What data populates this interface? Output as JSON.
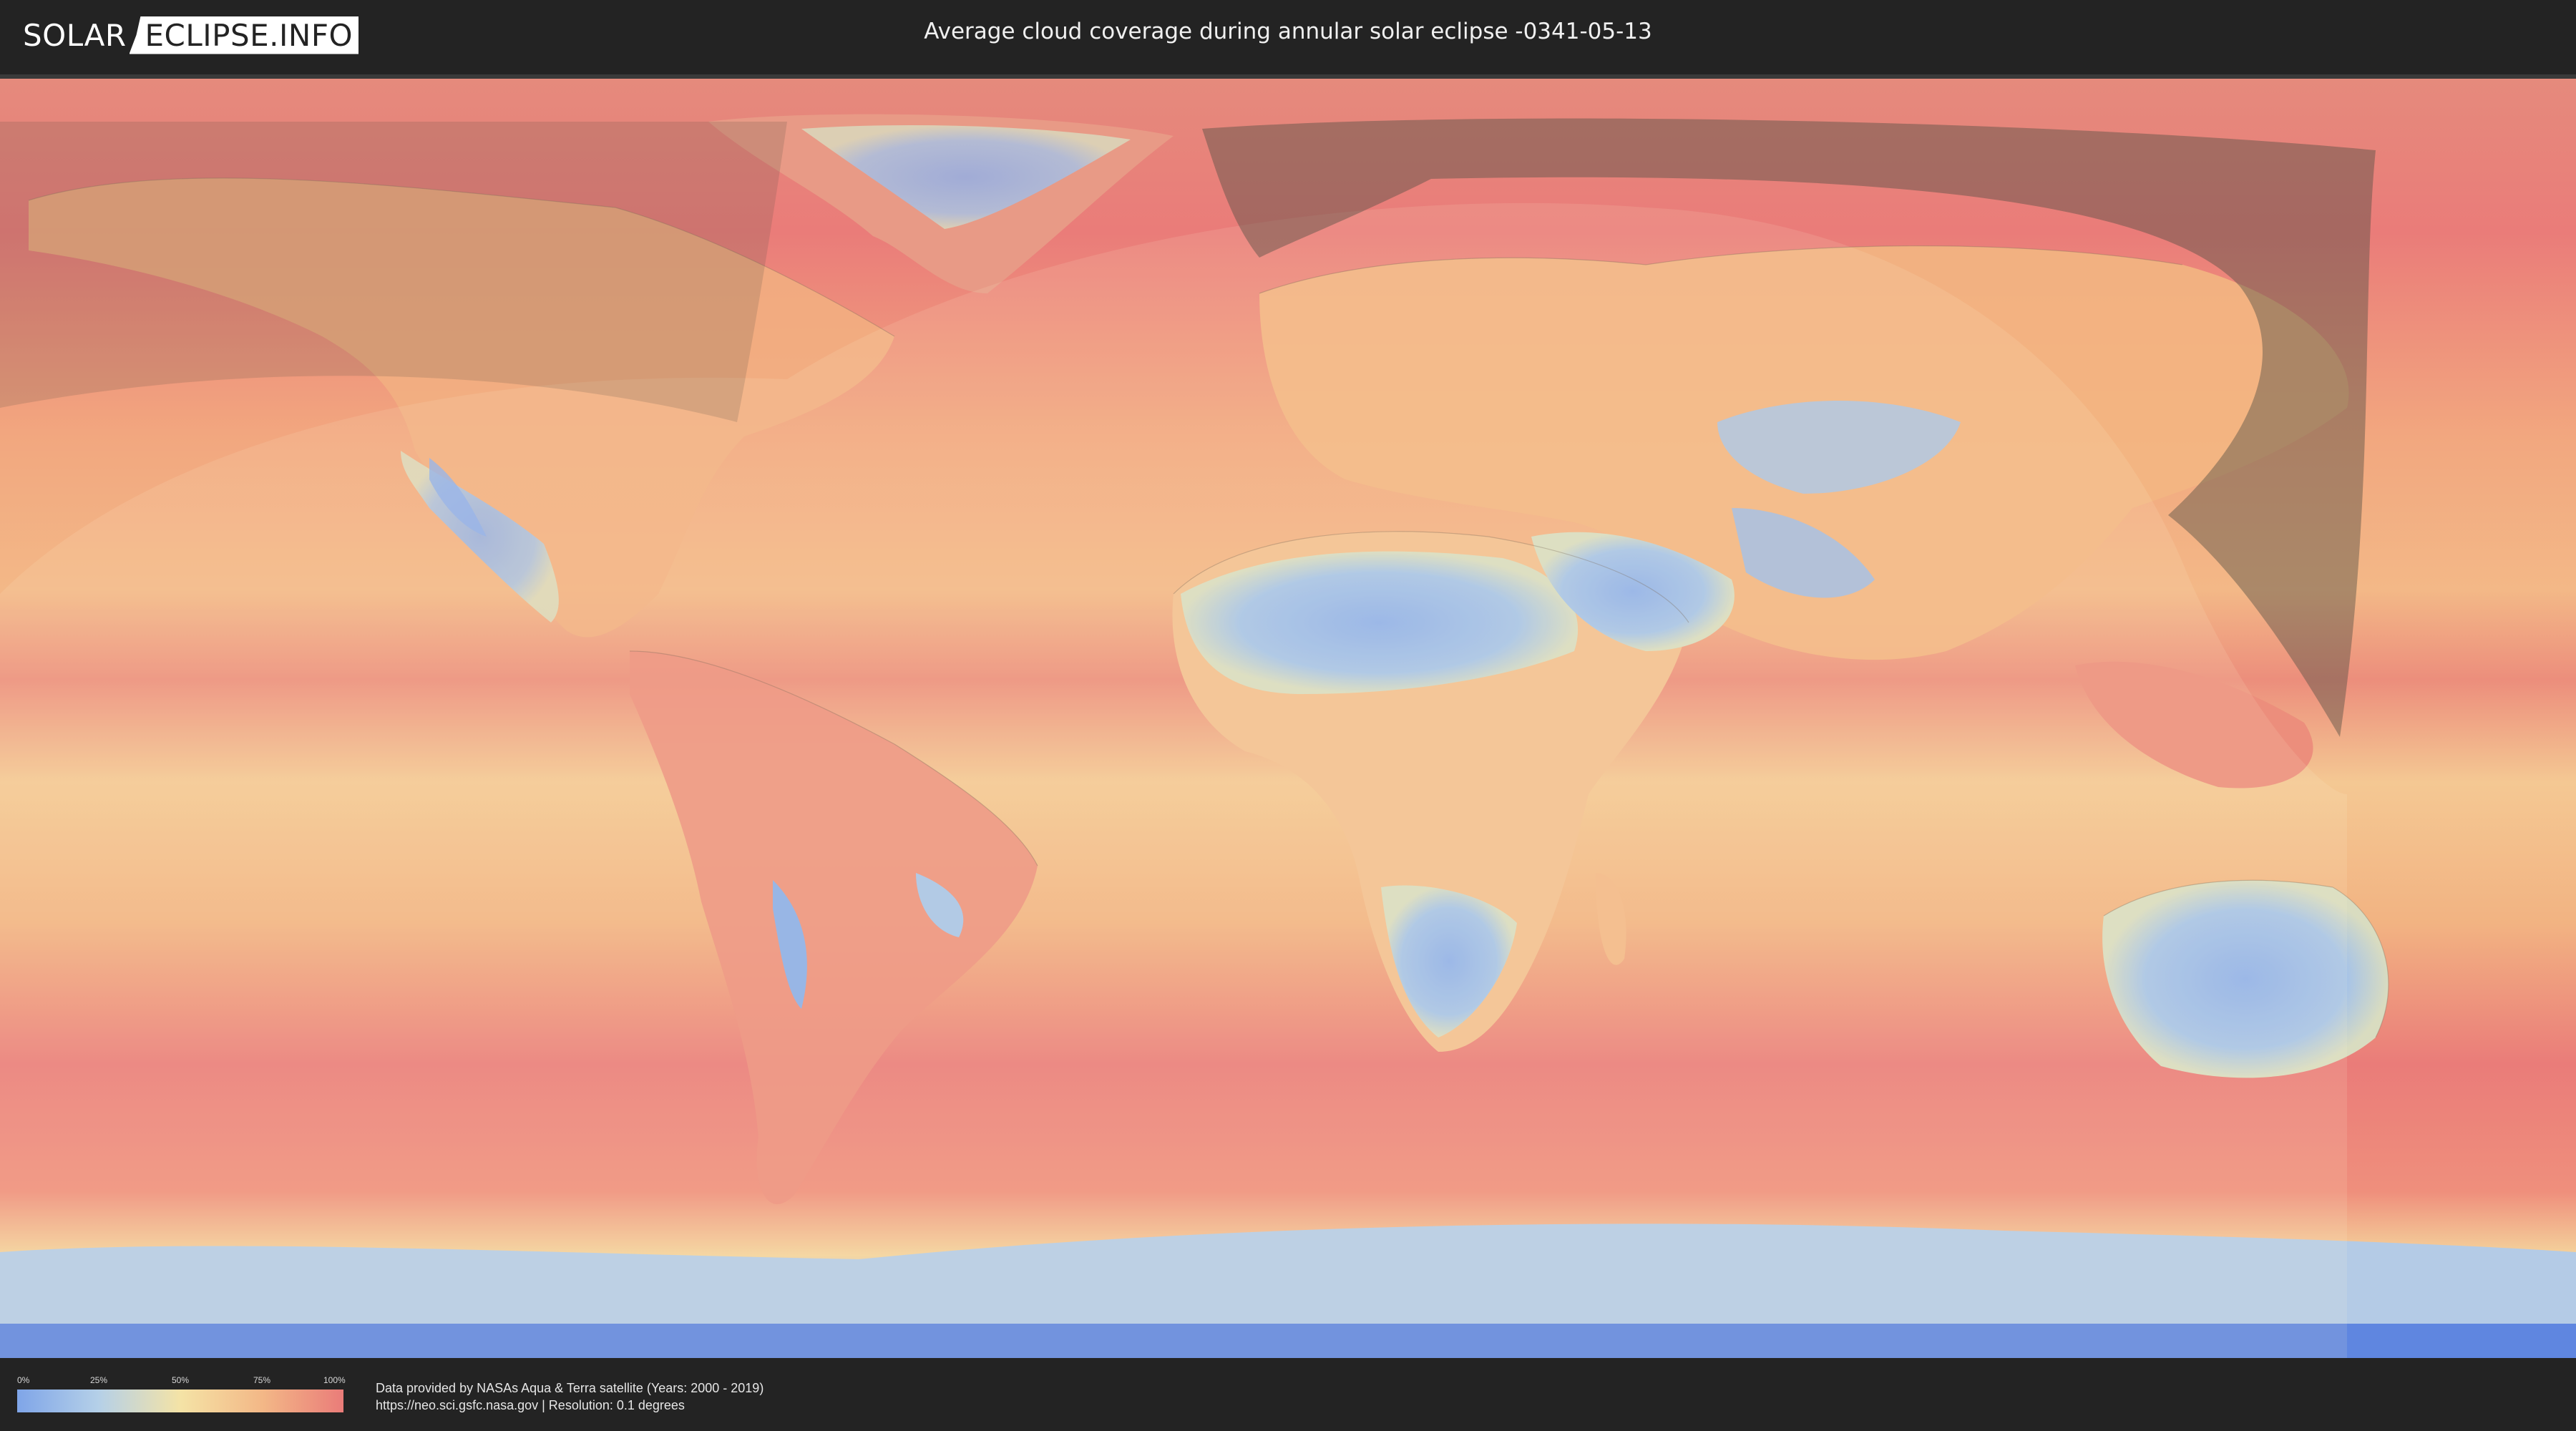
{
  "header": {
    "logo_part1": "SOLAR",
    "logo_part2": "ECLIPSE.INFO",
    "title": "Average cloud coverage during annular solar eclipse -0341-05-13"
  },
  "legend": {
    "ticks": [
      "0%",
      "25%",
      "50%",
      "75%",
      "100%"
    ],
    "colors": [
      "#7fa5e8",
      "#b5d0e8",
      "#f4e3a6",
      "#f3b887",
      "#ea7c79"
    ]
  },
  "footer": {
    "credit_line1": "Data provided by NASAs Aqua & Terra satellite (Years: 2000 - 2019)",
    "credit_line2": "https://neo.sci.gsfc.nasa.gov | Resolution: 0.1 degrees"
  },
  "map": {
    "colors": {
      "ocean_cloudy": "#ea7c79",
      "moderate": "#f3b887",
      "mid": "#f4e3a6",
      "clear": "#7fa5e8",
      "eclipse_shadow": "#555044"
    },
    "icons": [
      "world-map",
      "eclipse-shadow-band"
    ]
  }
}
